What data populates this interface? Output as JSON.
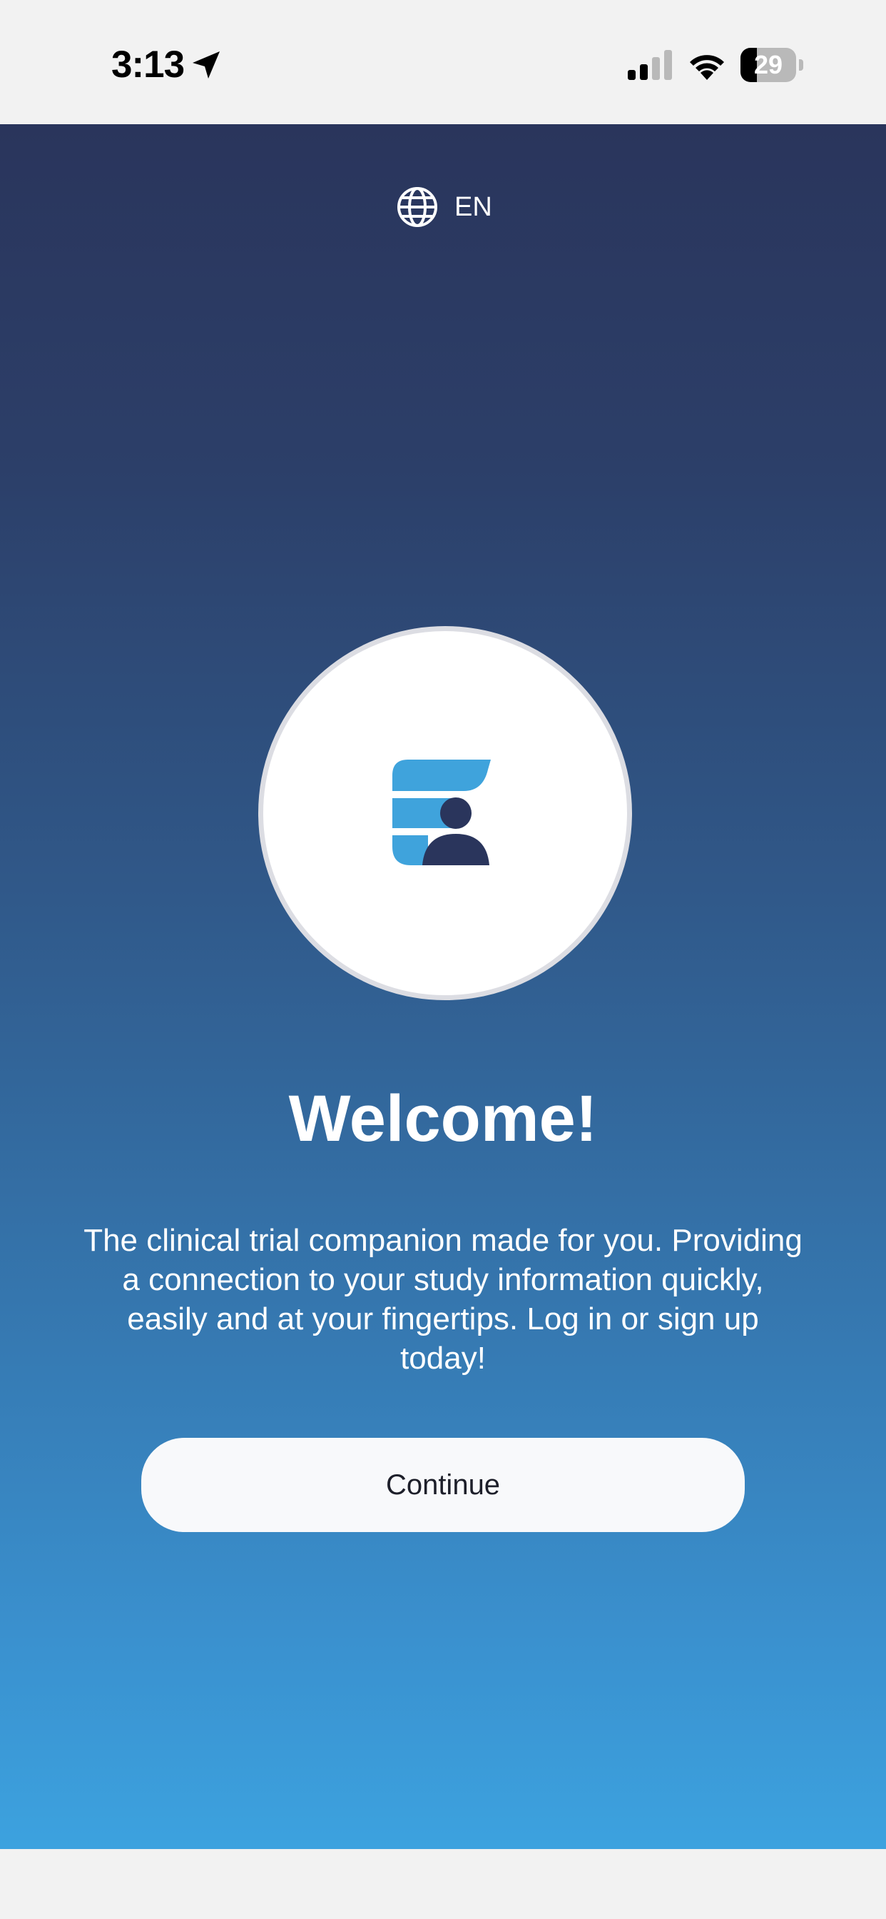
{
  "status_bar": {
    "time": "3:13",
    "battery_level": "29",
    "battery_fraction": 0.29,
    "icons": [
      "location-arrow-icon",
      "cellular-signal-icon",
      "wifi-icon",
      "battery-icon"
    ]
  },
  "header": {
    "language_label": "EN",
    "language_icon": "globe-icon"
  },
  "logo": {
    "icon": "app-logo",
    "colors": {
      "light_blue": "#3fa3dc",
      "navy": "#2a355c"
    }
  },
  "welcome": {
    "title": "Welcome!",
    "body": "The clinical trial companion made for you.  Providing\na connection to your study information quickly,\neasily and at your fingertips.  Log in or sign up\ntoday!"
  },
  "actions": {
    "continue_label": "Continue"
  },
  "theme": {
    "gradient_top": "#2a355c",
    "gradient_bottom": "#3ca2df",
    "button_bg": "#f8f9fb",
    "button_text": "#1d1f2a",
    "chrome_bg": "#f2f2f2"
  }
}
